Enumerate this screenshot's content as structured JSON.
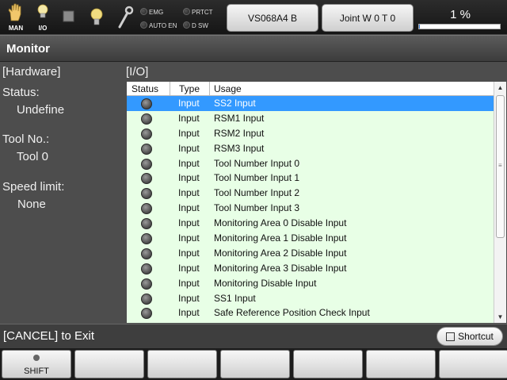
{
  "toolbar": {
    "man_label": "MAN",
    "io_label": "I/O",
    "lamps": {
      "emg": "EMG",
      "prtct": "PRTCT",
      "auto_en": "AUTO EN",
      "d_sw": "D SW"
    },
    "robot_button": "VS068A4 B",
    "joint_button": "Joint  W 0 T 0",
    "speed_text": "1 %",
    "speed_fraction": 0.01
  },
  "title": "Monitor",
  "left_panel": {
    "hardware": "[Hardware]",
    "status_label": "Status:",
    "status_value": "Undefine",
    "tool_label": "Tool No.:",
    "tool_value": "Tool 0",
    "speed_label": "Speed limit:",
    "speed_value": "None"
  },
  "io": {
    "title": "[I/O]",
    "headers": {
      "status": "Status",
      "type": "Type",
      "usage": "Usage"
    },
    "rows": [
      {
        "type": "Input",
        "usage": "SS2 Input"
      },
      {
        "type": "Input",
        "usage": "RSM1 Input"
      },
      {
        "type": "Input",
        "usage": "RSM2 Input"
      },
      {
        "type": "Input",
        "usage": "RSM3 Input"
      },
      {
        "type": "Input",
        "usage": "Tool Number Input 0"
      },
      {
        "type": "Input",
        "usage": "Tool Number Input 1"
      },
      {
        "type": "Input",
        "usage": "Tool Number Input 2"
      },
      {
        "type": "Input",
        "usage": "Tool Number Input 3"
      },
      {
        "type": "Input",
        "usage": "Monitoring Area 0 Disable Input"
      },
      {
        "type": "Input",
        "usage": "Monitoring Area 1 Disable Input"
      },
      {
        "type": "Input",
        "usage": "Monitoring Area 2 Disable Input"
      },
      {
        "type": "Input",
        "usage": "Monitoring Area 3 Disable Input"
      },
      {
        "type": "Input",
        "usage": "Monitoring Disable Input"
      },
      {
        "type": "Input",
        "usage": "SS1 Input"
      },
      {
        "type": "Input",
        "usage": "Safe Reference Position Check Input"
      }
    ]
  },
  "footer": {
    "exit_text": "[CANCEL] to Exit",
    "shortcut_label": "Shortcut"
  },
  "fkeys": [
    "SHIFT",
    "",
    "",
    "",
    "",
    "",
    ""
  ]
}
